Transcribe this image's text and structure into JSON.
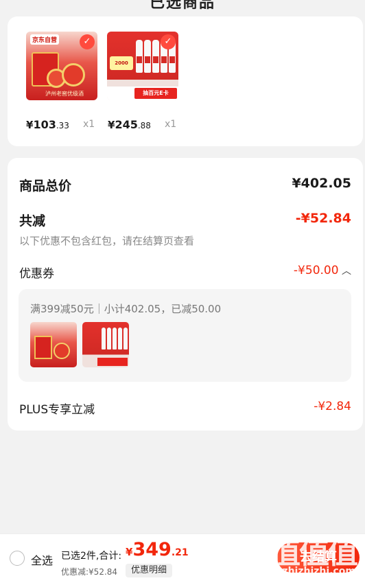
{
  "header": {
    "title_partial": "已选商品"
  },
  "products": [
    {
      "price_int": "103",
      "price_dec": ".33",
      "qty": "x1",
      "logo": "京东自营",
      "caption": "泸州老窖优级酒"
    },
    {
      "price_int": "245",
      "price_dec": ".88",
      "qty": "x1",
      "badge": "2000",
      "ecard": "抽百元E卡"
    }
  ],
  "currency": "¥",
  "summary": {
    "total_label": "商品总价",
    "total_value": "¥402.05",
    "reduce_label": "共减",
    "reduce_value": "-¥52.84",
    "note": "以下优惠不包含红包，请在结算页查看",
    "coupon_label": "优惠券",
    "coupon_value": "-¥50.00",
    "coupon_detail": "满399减50元｜小计402.05，已减50.00",
    "plus_label": "PLUS专享立减",
    "plus_value": "-¥2.84"
  },
  "bottom": {
    "select_all": "全选",
    "selected_info": "已选2件,合计:",
    "currency": "¥",
    "total_int": "349",
    "total_dec": ".21",
    "discount": "优惠减:¥52.84",
    "detail_btn": "优惠明细",
    "checkout": "去结算"
  },
  "watermark": {
    "text": "值值值",
    "url": "zhizhizhi.com"
  },
  "colors": {
    "accent": "#f2270c",
    "background": "#f2f2f2"
  }
}
